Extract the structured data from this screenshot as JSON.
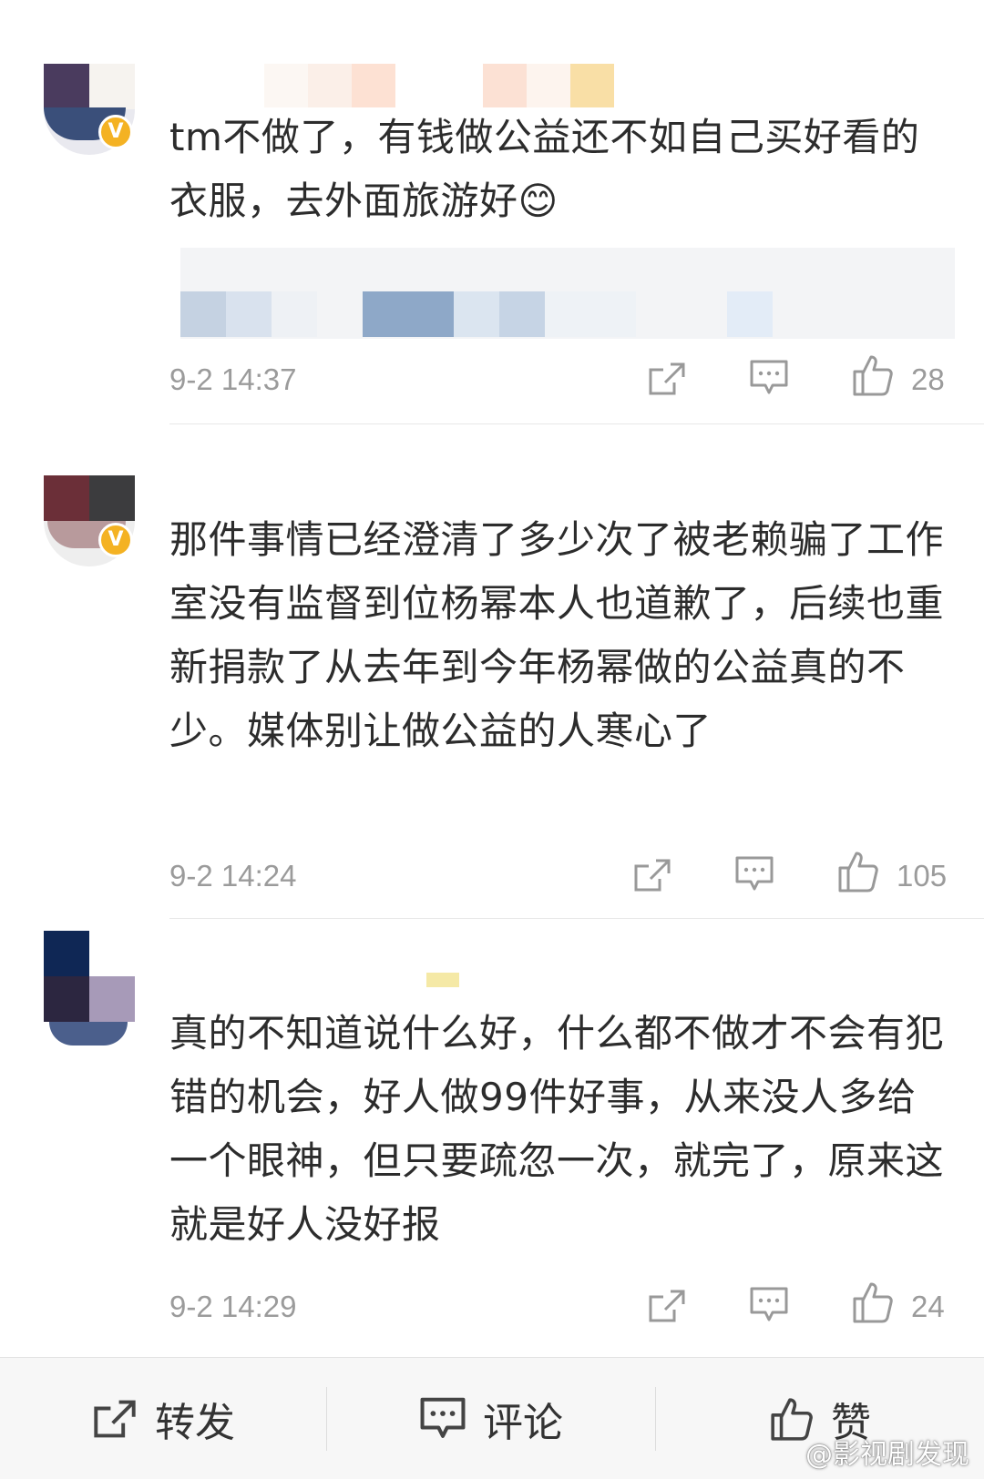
{
  "comments": [
    {
      "text": "tm不做了，有钱做公益还不如自己买好看的衣服，去外面旅游好😊",
      "time": "9-2 14:37",
      "likes": "28",
      "verified_badge": "V"
    },
    {
      "text": "那件事情已经澄清了多少次了被老赖骗了工作室没有监督到位杨幂本人也道歉了，后续也重新捐款了从去年到今年杨幂做的公益真的不少。媒体别让做公益的人寒心了",
      "time": "9-2 14:24",
      "likes": "105",
      "verified_badge": "V"
    },
    {
      "text": "真的不知道说什么好，什么都不做才不会有犯错的机会，好人做99件好事，从来没人多给一个眼神，但只要疏忽一次，就完了，原来这就是好人没好报",
      "time": "9-2 14:29",
      "likes": "24"
    }
  ],
  "bottom_bar": {
    "repost_label": "转发",
    "comment_label": "评论",
    "like_label": "赞"
  },
  "watermark": "@影视剧发现",
  "icons": {
    "repost": "share-icon",
    "comment": "comment-icon",
    "like": "thumbs-up-icon",
    "verified": "verified-badge-icon"
  },
  "colors": {
    "text": "#2c2c2c",
    "meta": "#9b9b9b",
    "verified_badge": "#f4b223",
    "bottom_bar_bg": "#f7f7f7"
  }
}
